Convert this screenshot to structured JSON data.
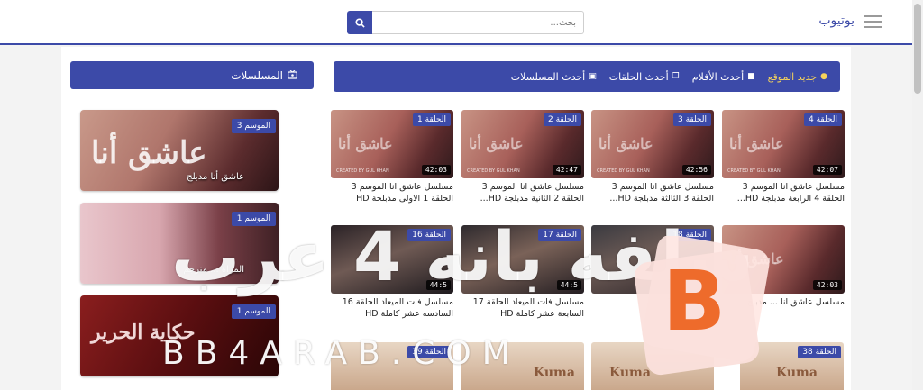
{
  "header": {
    "brand": "يوتيوب",
    "search_placeholder": "بحث...",
    "search_value": ""
  },
  "nav": {
    "items": [
      {
        "label": "جديد الموقع",
        "icon": "info-icon",
        "highlight": true
      },
      {
        "label": "أحدث الأفلام",
        "icon": "film-icon"
      },
      {
        "label": "أحدث الحلقات",
        "icon": "copy-icon"
      },
      {
        "label": "أحدث المسلسلات",
        "icon": "tv-icon"
      }
    ]
  },
  "sidebar": {
    "title": "المسلسلات",
    "title_icon": "tv-icon",
    "items": [
      {
        "season": "الموسم 3",
        "title": "عاشق أنا مدبلج",
        "art": "عاشق أنا"
      },
      {
        "season": "الموسم 1",
        "title": "المراة ... مترجم",
        "art": ""
      },
      {
        "season": "الموسم 1",
        "title": "",
        "art": "حكاية الحرير"
      }
    ]
  },
  "episodes": [
    {
      "badge": "الحلقة 4",
      "duration": "42:07",
      "title": "مسلسل عاشق انا الموسم 3 الحلقة 4 الرابعة مدبلجة HD...",
      "thumb_text": "عاشق أنا",
      "credit": "CREATED BY GUL KHAN"
    },
    {
      "badge": "الحلقة 3",
      "duration": "42:56",
      "title": "مسلسل عاشق انا الموسم 3 الحلقة 3 الثالثة مدبلجة HD...",
      "thumb_text": "عاشق أنا",
      "credit": "CREATED BY GUL KHAN"
    },
    {
      "badge": "الحلقة 2",
      "duration": "42:47",
      "title": "مسلسل عاشق انا الموسم 3 الحلقة 2 الثانية مدبلجة HD...",
      "thumb_text": "عاشق أنا",
      "credit": "CREATED BY GUL KHAN"
    },
    {
      "badge": "الحلقة 1",
      "duration": "42:03",
      "title": "مسلسل عاشق انا الموسم 3 الحلقة 1 الاولى مدبلجة HD",
      "thumb_text": "عاشق أنا",
      "credit": "CREATED BY GUL KHAN"
    },
    {
      "badge": "",
      "duration": "42:03",
      "title": "مسلسل عاشق انا ... مدبلج",
      "thumb_text": "عاشق أنا",
      "credit": ""
    },
    {
      "badge": "الحلقة 18",
      "duration": "",
      "title": "... الحلقة 18",
      "thumb_text": "",
      "credit": ""
    },
    {
      "badge": "الحلقة 17",
      "duration": "44:5",
      "title": "مسلسل فات الميعاد الحلقة 17 السابعة عشر كاملة HD",
      "thumb_text": "",
      "credit": ""
    },
    {
      "badge": "الحلقة 16",
      "duration": "44:5",
      "title": "مسلسل فات الميعاد الحلقة 16 السادسه عشر كاملة HD",
      "thumb_text": "",
      "credit": ""
    },
    {
      "badge": "الحلقة 38",
      "duration": "",
      "title": "",
      "thumb_text": "Kuma",
      "credit": ""
    },
    {
      "badge": "",
      "duration": "",
      "title": "",
      "thumb_text": "Kuma",
      "credit": ""
    },
    {
      "badge": "",
      "duration": "",
      "title": "",
      "thumb_text": "Kuma",
      "credit": ""
    },
    {
      "badge": "الحلقة 39",
      "duration": "",
      "title": "",
      "thumb_text": "",
      "credit": ""
    }
  ],
  "watermark": {
    "text": "سلفه بانه 4 عرب",
    "logo_letter": "B",
    "url": "BB4ARAB.COM"
  },
  "colors": {
    "primary": "#3c4aa8",
    "highlight": "#f6d35b",
    "watermark_orange": "#ee6b2b"
  }
}
